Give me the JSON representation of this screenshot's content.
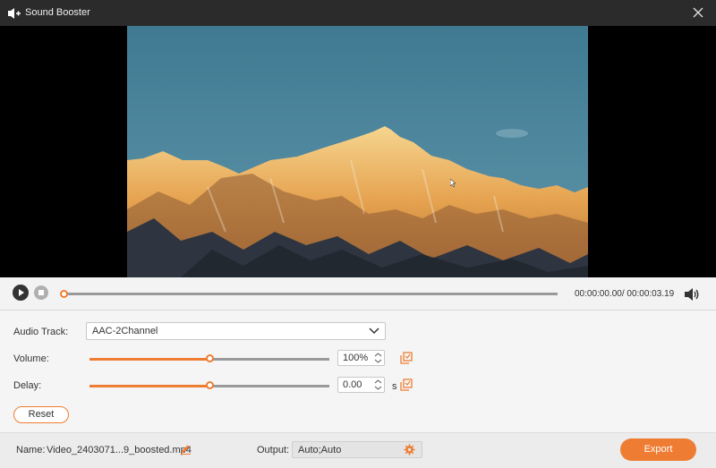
{
  "window": {
    "title": "Sound Booster"
  },
  "player": {
    "timecode": "00:00:00.00/ 00:00:03.19",
    "progress": 0
  },
  "audio_track": {
    "label": "Audio Track:",
    "selected": "AAC-2Channel"
  },
  "volume": {
    "label": "Volume:",
    "value": "100%",
    "level": 0.5
  },
  "delay": {
    "label": "Delay:",
    "value": "0.00",
    "unit": "s",
    "level": 0.5
  },
  "reset_label": "Reset",
  "footer": {
    "name_label": "Name:",
    "file_name": "Video_2403071...9_boosted.mp4",
    "output_label": "Output:",
    "output_value": "Auto;Auto",
    "export_label": "Export"
  },
  "colors": {
    "accent": "#ee7d33",
    "titlebar": "#2b2b2b"
  },
  "icons": [
    "speaker-plus-icon",
    "close-icon",
    "play-icon",
    "stop-icon",
    "volume-icon",
    "chevron-down-icon",
    "copy-icon",
    "edit-icon",
    "gear-icon"
  ]
}
